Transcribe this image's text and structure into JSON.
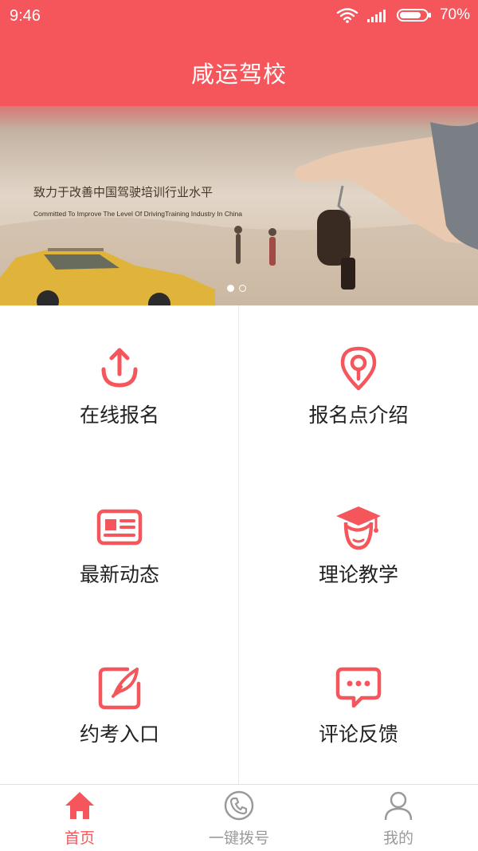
{
  "status_bar": {
    "time": "9:46",
    "battery": "70%"
  },
  "header": {
    "title": "咸运驾校"
  },
  "banner": {
    "headline_cn": "致力于改善中国驾驶培训行业水平",
    "headline_en": "Committed To Improve The Level Of DrivingTraining Industry In China",
    "slide_count": 2,
    "active_slide": 1
  },
  "grid": [
    {
      "label": "在线报名",
      "icon": "upload-icon"
    },
    {
      "label": "报名点介绍",
      "icon": "location-pin-icon"
    },
    {
      "label": "最新动态",
      "icon": "news-icon"
    },
    {
      "label": "理论教学",
      "icon": "graduate-icon"
    },
    {
      "label": "约考入口",
      "icon": "edit-icon"
    },
    {
      "label": "评论反馈",
      "icon": "chat-icon"
    }
  ],
  "bottom_nav": [
    {
      "label": "首页",
      "icon": "home-icon",
      "active": true
    },
    {
      "label": "一键拨号",
      "icon": "phone-icon",
      "active": false
    },
    {
      "label": "我的",
      "icon": "user-icon",
      "active": false
    }
  ],
  "colors": {
    "accent": "#f5565c",
    "inactive": "#9a9a9a",
    "divider": "#e8e8e8"
  }
}
